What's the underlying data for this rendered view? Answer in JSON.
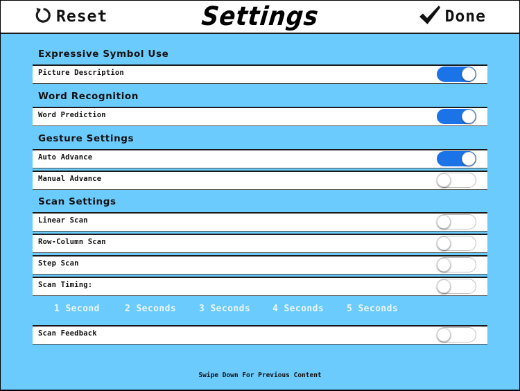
{
  "header": {
    "reset_label": "Reset",
    "title": "Settings",
    "done_label": "Done"
  },
  "sections": [
    {
      "title": "Expressive Symbol Use",
      "rows": [
        {
          "label": "Picture Description",
          "on": true
        }
      ]
    },
    {
      "title": "Word Recognition",
      "rows": [
        {
          "label": "Word Prediction",
          "on": true
        }
      ]
    },
    {
      "title": "Gesture Settings",
      "rows": [
        {
          "label": "Auto Advance",
          "on": true
        },
        {
          "label": "Manual Advance",
          "on": false
        }
      ]
    },
    {
      "title": "Scan Settings",
      "rows": [
        {
          "label": "Linear Scan",
          "on": false
        },
        {
          "label": "Row-Column Scan",
          "on": false
        },
        {
          "label": "Step Scan",
          "on": false
        },
        {
          "label": "Scan Timing:",
          "on": false
        }
      ]
    }
  ],
  "scan_timing_options": [
    "1 Second",
    "2 Seconds",
    "3 Seconds",
    "4 Seconds",
    "5 Seconds"
  ],
  "scan_feedback": {
    "label": "Scan Feedback",
    "on": false
  },
  "footer_note": "Swipe Down For Previous Content",
  "colors": {
    "background": "#6ccbfd",
    "toggle_on": "#1a74e8",
    "header_bg": "#ffffff"
  },
  "icons": {
    "reset": "refresh-icon",
    "done": "checkmark-icon"
  }
}
